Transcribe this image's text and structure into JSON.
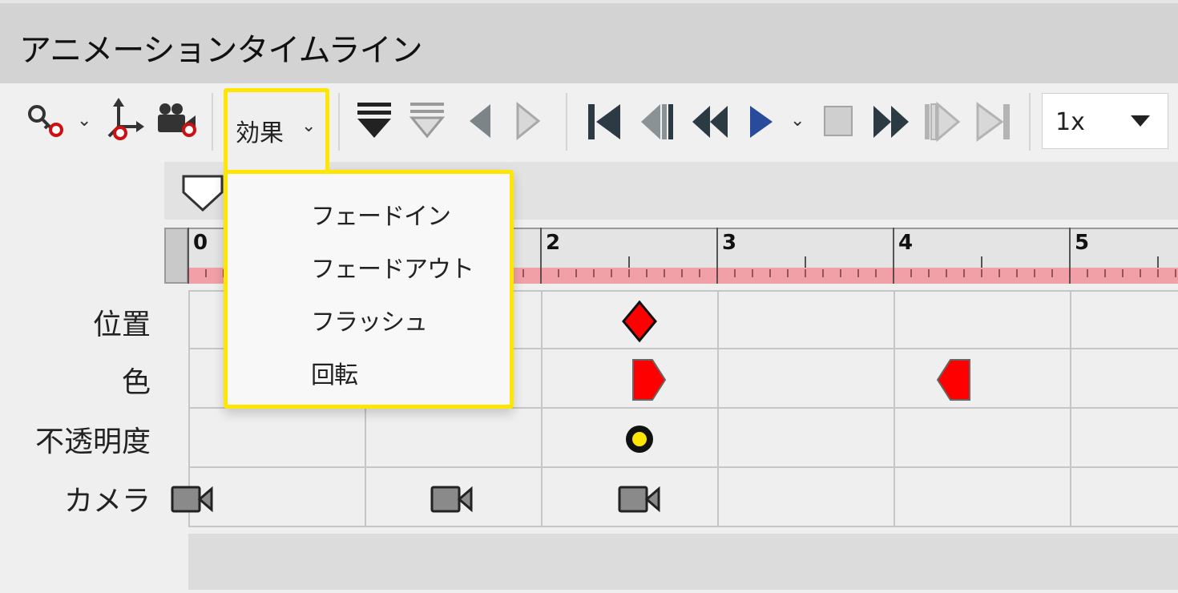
{
  "window": {
    "title": "アニメーションタイムライン"
  },
  "toolbar": {
    "tools": [
      "key-tool-icon",
      "move-axis-tool-icon",
      "camera-record-icon"
    ],
    "effects_label": "効果",
    "speed_value": "1x",
    "speed_options_visible": [
      "1x"
    ],
    "nav_buttons": [
      "insert-keyframe-icon",
      "remove-keyframe-icon",
      "prev-arrow-icon",
      "next-arrow-icon",
      "go-start-icon",
      "step-back-icon",
      "rewind-icon",
      "play-icon",
      "stop-icon",
      "fast-forward-icon",
      "step-forward-icon",
      "go-end-icon"
    ]
  },
  "effects_menu": {
    "items": [
      "フェードイン",
      "フェードアウト",
      "フラッシュ",
      "回転"
    ]
  },
  "ruler": {
    "labels": [
      "0",
      "2",
      "3",
      "4",
      "5"
    ]
  },
  "tracks": [
    {
      "label": "位置",
      "keyframes": [
        {
          "time": 2.55,
          "shape": "diamond",
          "color": "#ff0000"
        }
      ]
    },
    {
      "label": "色",
      "keyframes": [
        {
          "time": 2.55,
          "shape": "ease-out",
          "color": "#ff0000"
        },
        {
          "time": 4.3,
          "shape": "ease-in",
          "color": "#ff0000"
        }
      ]
    },
    {
      "label": "不透明度",
      "keyframes": [
        {
          "time": 2.55,
          "shape": "circle",
          "color": "#ffe600"
        }
      ]
    },
    {
      "label": "カメラ",
      "keyframes": [
        {
          "time": 0.0,
          "shape": "camera"
        },
        {
          "time": 1.5,
          "shape": "camera"
        },
        {
          "time": 2.55,
          "shape": "camera"
        }
      ]
    }
  ],
  "colors": {
    "highlight": "#ffe600",
    "keyframe": "#ff0000",
    "ruler_band": "#f2a0a8",
    "play_blue": "#2a4a9c"
  }
}
